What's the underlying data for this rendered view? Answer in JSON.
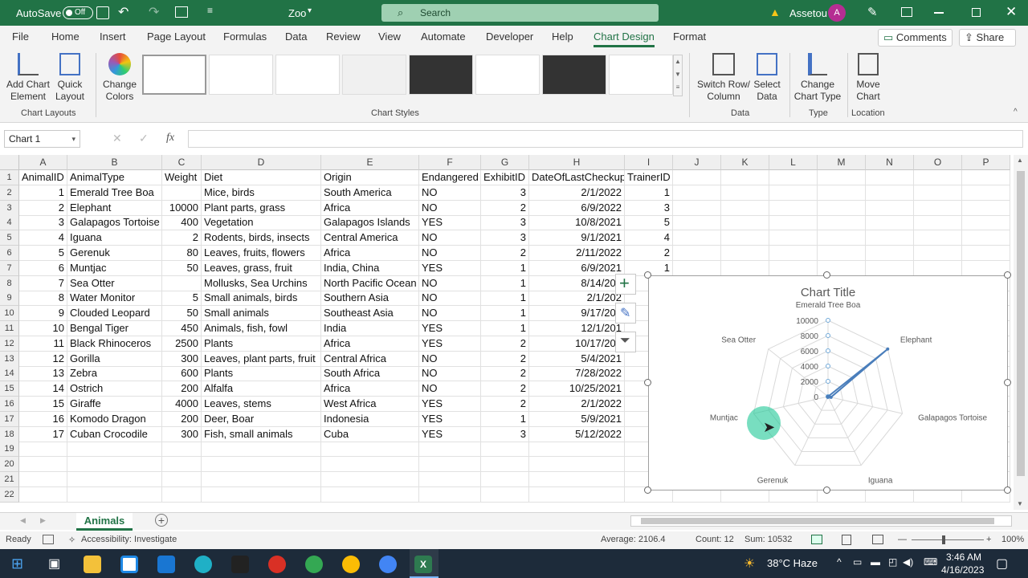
{
  "titlebar": {
    "autosave": "AutoSave",
    "toggle": "Off",
    "filename": "Zoo",
    "search": "Search",
    "user": "Assetou",
    "avatar": "A"
  },
  "menu": [
    "File",
    "Home",
    "Insert",
    "Page Layout",
    "Formulas",
    "Data",
    "Review",
    "View",
    "Automate",
    "Developer",
    "Help",
    "Chart Design",
    "Format"
  ],
  "menu_active": "Chart Design",
  "comments": "Comments",
  "share": "Share",
  "ribbon": {
    "add_chart_element": "Add Chart\nElement",
    "quick_layout": "Quick\nLayout",
    "change_colors": "Change\nColors",
    "switch_row_col": "Switch Row/\nColumn",
    "select_data": "Select\nData",
    "change_chart_type": "Change\nChart Type",
    "move_chart": "Move\nChart",
    "grp_layouts": "Chart Layouts",
    "grp_styles": "Chart Styles",
    "grp_data": "Data",
    "grp_type": "Type",
    "grp_location": "Location"
  },
  "namebox": "Chart 1",
  "fx": "fx",
  "columns": [
    "A",
    "B",
    "C",
    "D",
    "E",
    "F",
    "G",
    "H",
    "I",
    "J",
    "K",
    "L",
    "M",
    "N",
    "O",
    "P"
  ],
  "rows": [
    [
      "AnimalID",
      "AnimalType",
      "Weight",
      "Diet",
      "Origin",
      "Endangered",
      "ExhibitID",
      "DateOfLastCheckup",
      "TrainerID"
    ],
    [
      "1",
      "Emerald Tree Boa",
      "",
      "Mice, birds",
      "South America",
      "NO",
      "3",
      "2/1/2022",
      "1"
    ],
    [
      "2",
      "Elephant",
      "10000",
      "Plant parts, grass",
      "Africa",
      "NO",
      "2",
      "6/9/2022",
      "3"
    ],
    [
      "3",
      "Galapagos Tortoise",
      "400",
      "Vegetation",
      "Galapagos Islands",
      "YES",
      "3",
      "10/8/2021",
      "5"
    ],
    [
      "4",
      "Iguana",
      "2",
      "Rodents, birds, insects",
      "Central America",
      "NO",
      "3",
      "9/1/2021",
      "4"
    ],
    [
      "5",
      "Gerenuk",
      "80",
      "Leaves, fruits, flowers",
      "Africa",
      "NO",
      "2",
      "2/11/2022",
      "2"
    ],
    [
      "6",
      "Muntjac",
      "50",
      "Leaves, grass, fruit",
      "India, China",
      "YES",
      "1",
      "6/9/2021",
      "1"
    ],
    [
      "7",
      "Sea Otter",
      "",
      "Mollusks, Sea Urchins",
      "North Pacific Ocean",
      "NO",
      "1",
      "8/14/202",
      ""
    ],
    [
      "8",
      "Water Monitor",
      "5",
      "Small animals, birds",
      "Southern Asia",
      "NO",
      "1",
      "2/1/202",
      ""
    ],
    [
      "9",
      "Clouded Leopard",
      "50",
      "Small animals",
      "Southeast Asia",
      "NO",
      "1",
      "9/17/202",
      ""
    ],
    [
      "10",
      "Bengal Tiger",
      "450",
      "Animals, fish, fowl",
      "India",
      "YES",
      "1",
      "12/1/201",
      ""
    ],
    [
      "11",
      "Black Rhinoceros",
      "2500",
      "Plants",
      "Africa",
      "YES",
      "2",
      "10/17/202",
      ""
    ],
    [
      "12",
      "Gorilla",
      "300",
      "Leaves, plant parts, fruit",
      "Central Africa",
      "NO",
      "2",
      "5/4/2021",
      ""
    ],
    [
      "13",
      "Zebra",
      "600",
      "Plants",
      "South Africa",
      "NO",
      "2",
      "7/28/2022",
      ""
    ],
    [
      "14",
      "Ostrich",
      "200",
      "Alfalfa",
      "Africa",
      "NO",
      "2",
      "10/25/2021",
      ""
    ],
    [
      "15",
      "Giraffe",
      "4000",
      "Leaves, stems",
      "West Africa",
      "YES",
      "2",
      "2/1/2022",
      ""
    ],
    [
      "16",
      "Komodo Dragon",
      "200",
      "Deer, Boar",
      "Indonesia",
      "YES",
      "1",
      "5/9/2021",
      ""
    ],
    [
      "17",
      "Cuban Crocodile",
      "300",
      "Fish, small animals",
      "Cuba",
      "YES",
      "3",
      "5/12/2022",
      ""
    ],
    [
      "",
      "",
      "",
      "",
      "",
      "",
      "",
      "",
      ""
    ],
    [
      "",
      "",
      "",
      "",
      "",
      "",
      "",
      "",
      ""
    ],
    [
      "",
      "",
      "",
      "",
      "",
      "",
      "",
      "",
      ""
    ],
    [
      "",
      "",
      "",
      "",
      "",
      "",
      "",
      "",
      ""
    ]
  ],
  "chart_data": {
    "type": "radar",
    "title": "Chart Title",
    "categories": [
      "Emerald Tree Boa",
      "Elephant",
      "Galapagos Tortoise",
      "Iguana",
      "Gerenuk",
      "Muntjac",
      "Sea Otter"
    ],
    "values": [
      0,
      10000,
      400,
      2,
      80,
      50,
      0
    ],
    "rlim": [
      0,
      10000
    ],
    "ticks": [
      "10000",
      "8000",
      "6000",
      "4000",
      "2000",
      "0"
    ]
  },
  "sheet_tab": "Animals",
  "status": {
    "ready": "Ready",
    "accessibility": "Accessibility: Investigate",
    "average": "Average: 2106.4",
    "count": "Count: 12",
    "sum": "Sum: 10532",
    "zoom": "100%"
  },
  "taskbar": {
    "weather": "38°C  Haze",
    "time": "3:46 AM",
    "date": "4/16/2023"
  }
}
